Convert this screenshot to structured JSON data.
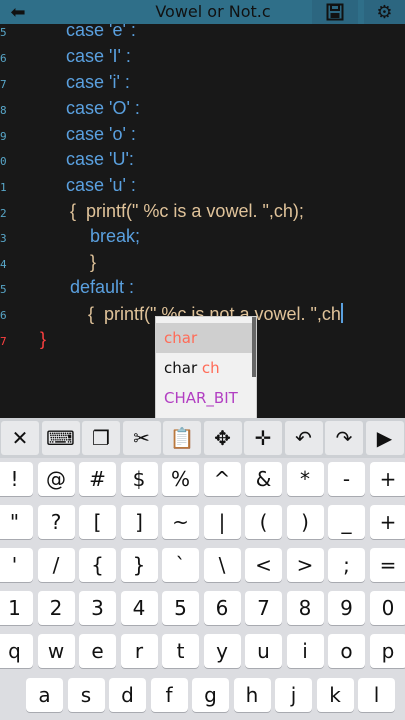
{
  "toolbar": {
    "back_icon": "arrow-left-icon",
    "title": "Vowel or Not.c",
    "save_icon": "floppy-disk-icon",
    "settings_icon": "gear-icon"
  },
  "editor": {
    "line_numbers": [
      "5",
      "6",
      "7",
      "8",
      "9",
      "0",
      "1",
      "2",
      "3",
      "4",
      "5",
      "6",
      "7"
    ],
    "lines": [
      "case 'e' :",
      "case 'I' :",
      "case 'i' :",
      "case 'O' :",
      "case 'o' :",
      "case 'U':",
      "case 'u' :",
      "{  printf(\" %c is a vowel. \",ch);",
      "break;",
      "}",
      "default :",
      "{  printf(\" %c is not a vowel. \",ch",
      "}"
    ]
  },
  "autocomplete": {
    "items": [
      {
        "label": "char",
        "match": "",
        "selected": true
      },
      {
        "label": "char ",
        "match": "ch",
        "selected": false
      },
      {
        "label": "CHAR_BIT",
        "match": "",
        "selected": false
      }
    ]
  },
  "keyboard": {
    "tools": [
      {
        "name": "clear-icon",
        "glyph": "✕"
      },
      {
        "name": "keyboard-icon",
        "glyph": "⌨"
      },
      {
        "name": "copy-icon",
        "glyph": "❐"
      },
      {
        "name": "cut-icon",
        "glyph": "✂"
      },
      {
        "name": "paste-icon",
        "glyph": "📋"
      },
      {
        "name": "move-cursor-icon",
        "glyph": "✥"
      },
      {
        "name": "select-icon",
        "glyph": "✛"
      },
      {
        "name": "undo-icon",
        "glyph": "↶"
      },
      {
        "name": "redo-icon",
        "glyph": "↷"
      },
      {
        "name": "run-icon",
        "glyph": "▶"
      }
    ],
    "rows": [
      [
        "!",
        "@",
        "#",
        "$",
        "%",
        "^",
        "&",
        "*",
        "-",
        "+"
      ],
      [
        "\"",
        "?",
        "[",
        "]",
        "~",
        "|",
        "(",
        ")",
        "_",
        "+"
      ],
      [
        "'",
        "/",
        "{",
        "}",
        "`",
        "\\",
        "<",
        ">",
        ";",
        "="
      ],
      [
        "1",
        "2",
        "3",
        "4",
        "5",
        "6",
        "7",
        "8",
        "9",
        "0"
      ],
      [
        "q",
        "w",
        "e",
        "r",
        "t",
        "y",
        "u",
        "i",
        "o",
        "p"
      ],
      [
        "a",
        "s",
        "d",
        "f",
        "g",
        "h",
        "j",
        "k",
        "l"
      ]
    ]
  },
  "colors": {
    "toolbar_bg": "#2f6f89",
    "editor_bg": "#181818",
    "keyword": "#5aa0df",
    "string": "#e0c39a",
    "brace_error": "#ff4040",
    "autocomplete_primary": "#ff6b57",
    "autocomplete_macro": "#b23ec2"
  }
}
